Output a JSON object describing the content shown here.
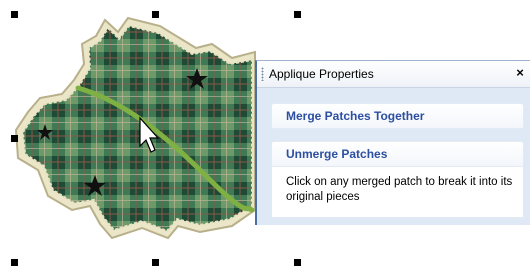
{
  "panel": {
    "title": "Applique Properties",
    "close_glyph": "×",
    "sections": [
      {
        "label": "Merge Patches Together"
      },
      {
        "label": "Unmerge Patches",
        "description": "Click on any merged patch to break it into its original pieces"
      }
    ]
  },
  "colors": {
    "patch_dark_green": "#1f4a35",
    "patch_mid_green": "#3f7a55",
    "stitch_outline": "#c9c19a",
    "stem_green": "#7fb043",
    "panel_bg": "#dfe9f5",
    "link_blue": "#2c4fa0"
  },
  "icons": [
    "selection-handle-icon",
    "arrow-cursor-icon",
    "close-icon"
  ]
}
